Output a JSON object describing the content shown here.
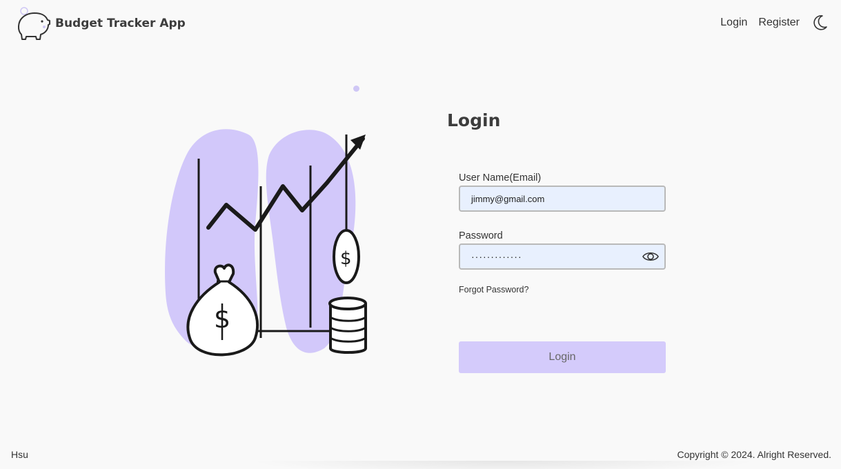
{
  "header": {
    "app_name": "Budget Tracker App",
    "nav": {
      "login": "Login",
      "register": "Register"
    }
  },
  "form": {
    "title": "Login",
    "username_label": "User Name(Email)",
    "username_value": "jimmy@gmail.com",
    "password_label": "Password",
    "password_masked": "·············",
    "forgot": "Forgot Password?",
    "submit": "Login"
  },
  "footer": {
    "left": "Hsu",
    "right": "Copyright © 2024. Alright Reserved."
  },
  "icons": {
    "logo": "piggy-bank-icon",
    "theme": "moon-icon",
    "toggle_password": "eye-icon"
  },
  "colors": {
    "accent": "#d4cbfb",
    "input_bg": "#e8f0fe",
    "background": "#f9f9f9"
  }
}
